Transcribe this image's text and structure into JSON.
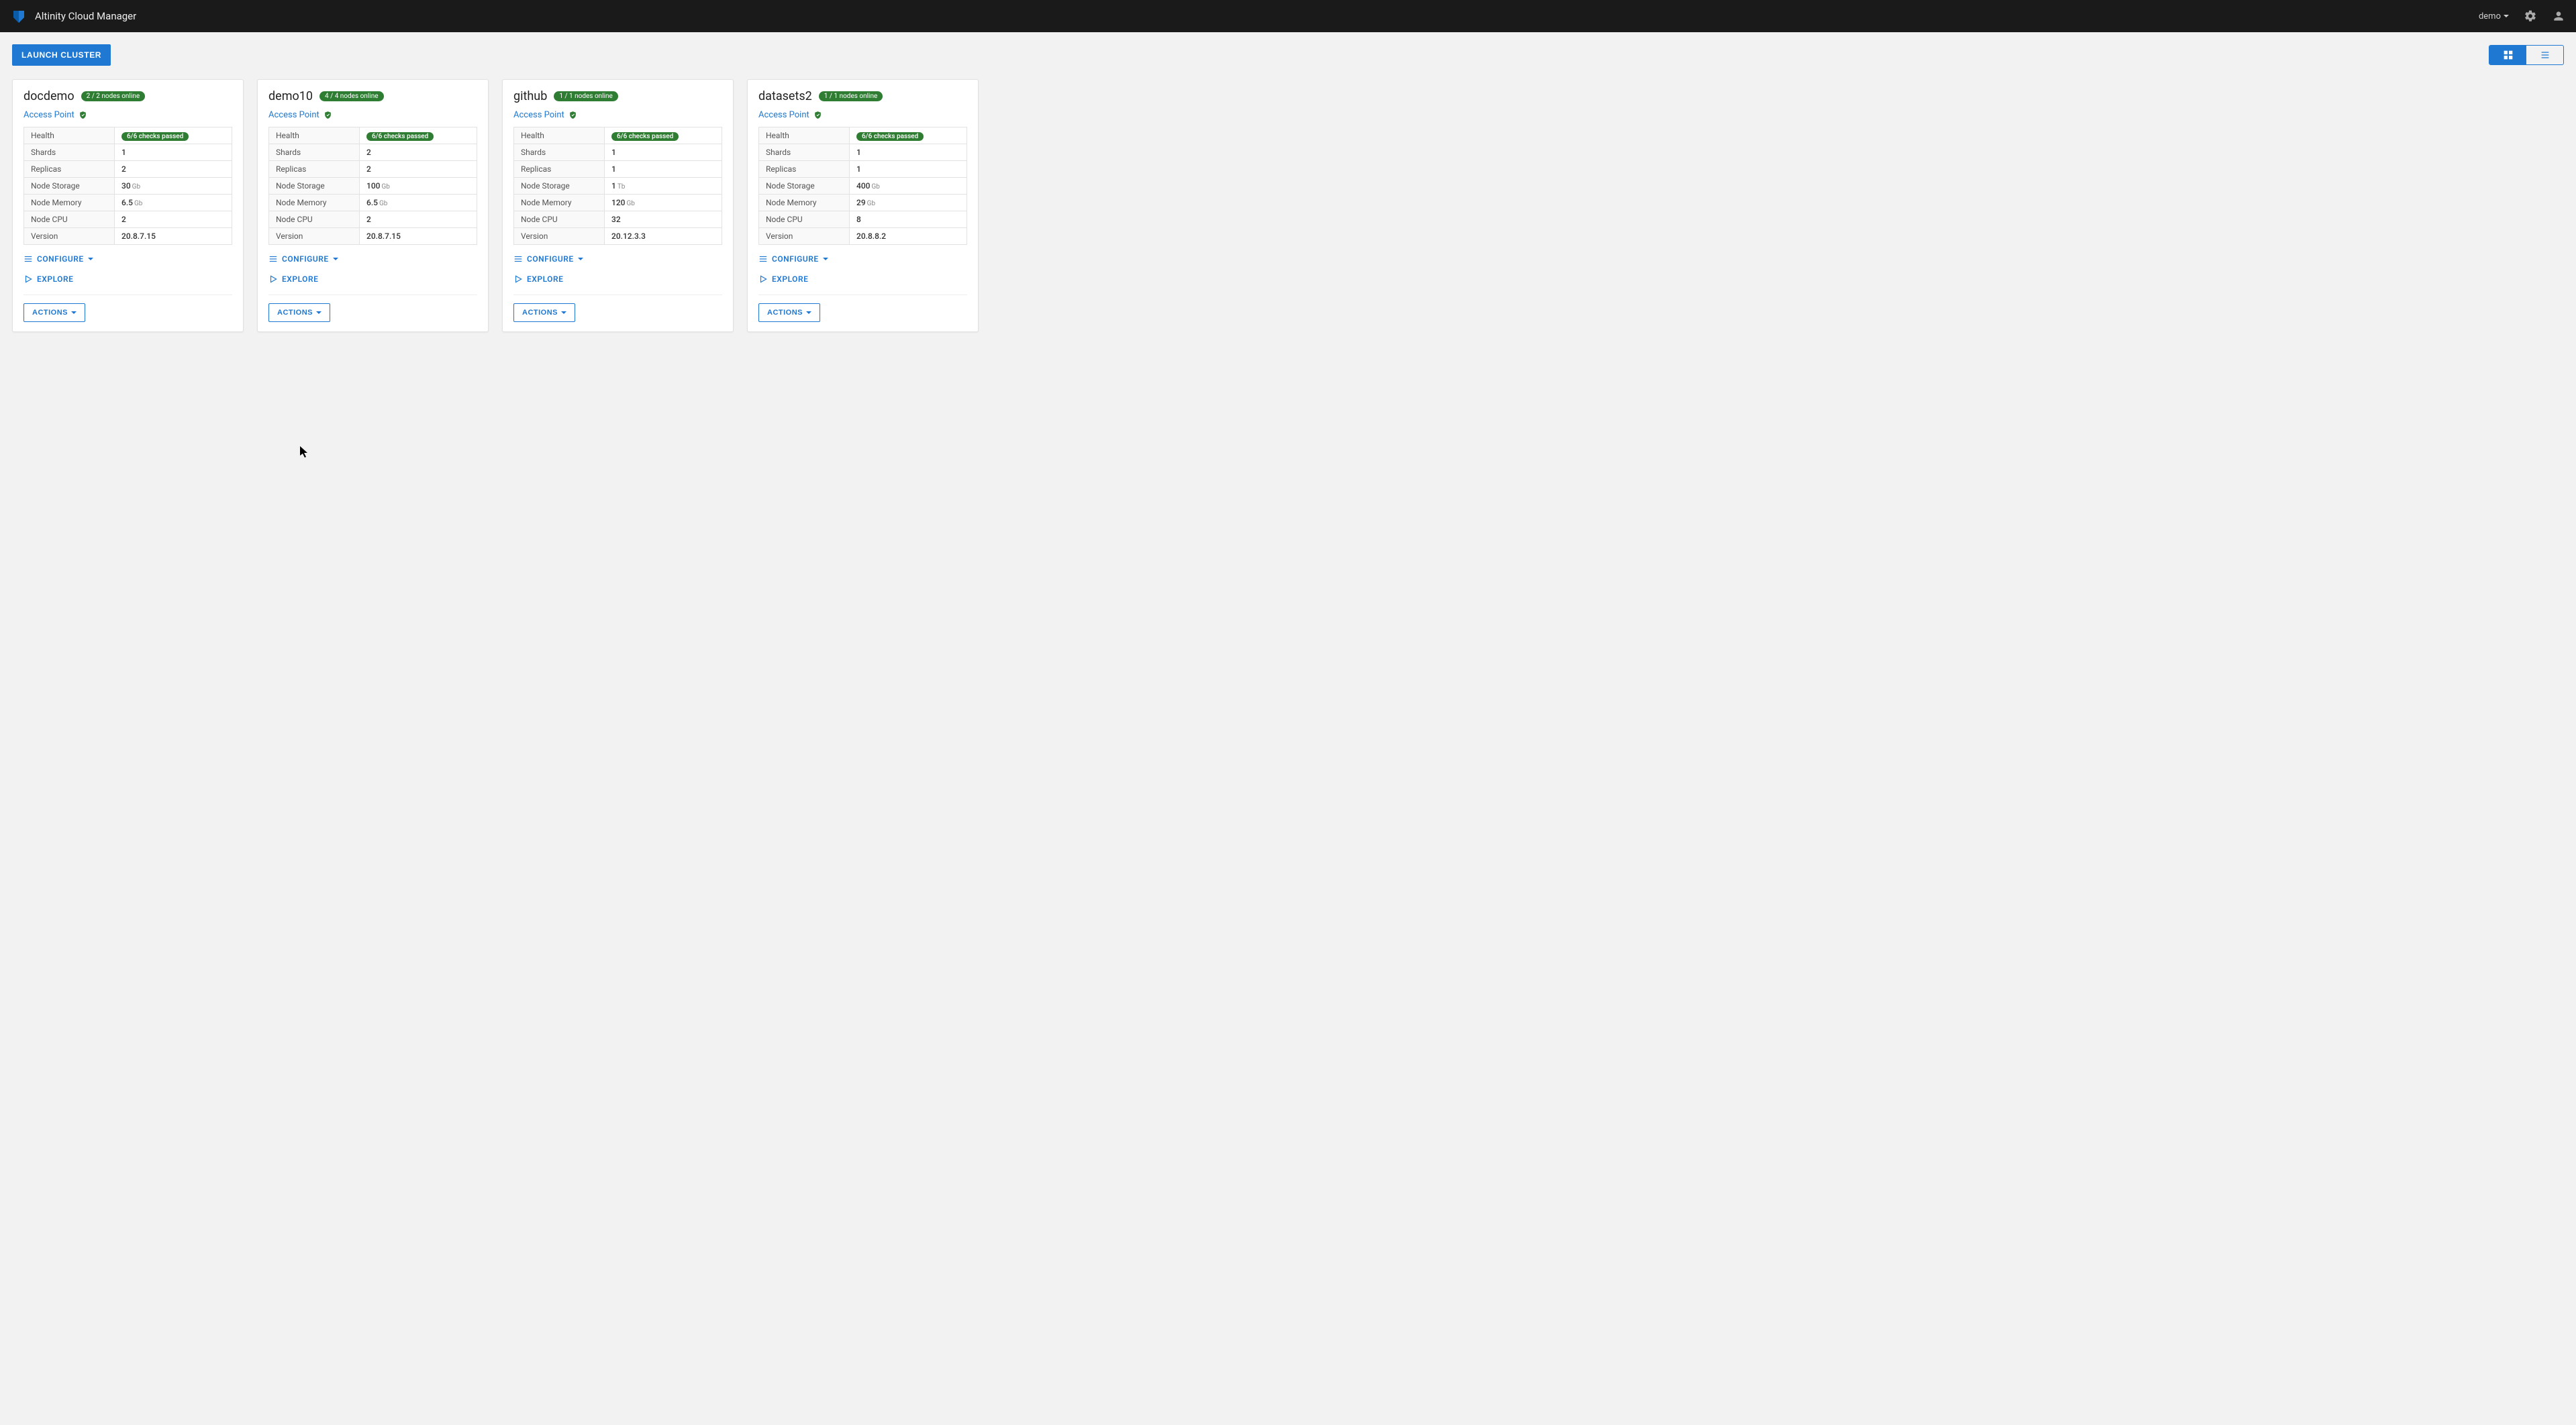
{
  "app": {
    "title": "Altinity Cloud Manager",
    "current_user": "demo"
  },
  "buttons": {
    "launch": "LAUNCH CLUSTER",
    "configure": "CONFIGURE",
    "explore": "EXPLORE",
    "actions": "ACTIONS"
  },
  "labels": {
    "access_point": "Access Point",
    "health": "Health",
    "shards": "Shards",
    "replicas": "Replicas",
    "node_storage": "Node Storage",
    "node_memory": "Node Memory",
    "node_cpu": "Node CPU",
    "version": "Version"
  },
  "clusters": [
    {
      "name": "docdemo",
      "nodes_pill": "2 / 2 nodes online",
      "health_pill": "6/6 checks passed",
      "shards": "1",
      "replicas": "2",
      "storage_val": "30",
      "storage_unit": "Gb",
      "memory_val": "6.5",
      "memory_unit": "Gb",
      "cpu": "2",
      "version": "20.8.7.15"
    },
    {
      "name": "demo10",
      "nodes_pill": "4 / 4 nodes online",
      "health_pill": "6/6 checks passed",
      "shards": "2",
      "replicas": "2",
      "storage_val": "100",
      "storage_unit": "Gb",
      "memory_val": "6.5",
      "memory_unit": "Gb",
      "cpu": "2",
      "version": "20.8.7.15"
    },
    {
      "name": "github",
      "nodes_pill": "1 / 1 nodes online",
      "health_pill": "6/6 checks passed",
      "shards": "1",
      "replicas": "1",
      "storage_val": "1",
      "storage_unit": "Tb",
      "memory_val": "120",
      "memory_unit": "Gb",
      "cpu": "32",
      "version": "20.12.3.3"
    },
    {
      "name": "datasets2",
      "nodes_pill": "1 / 1 nodes online",
      "health_pill": "6/6 checks passed",
      "shards": "1",
      "replicas": "1",
      "storage_val": "400",
      "storage_unit": "Gb",
      "memory_val": "29",
      "memory_unit": "Gb",
      "cpu": "8",
      "version": "20.8.8.2"
    }
  ]
}
